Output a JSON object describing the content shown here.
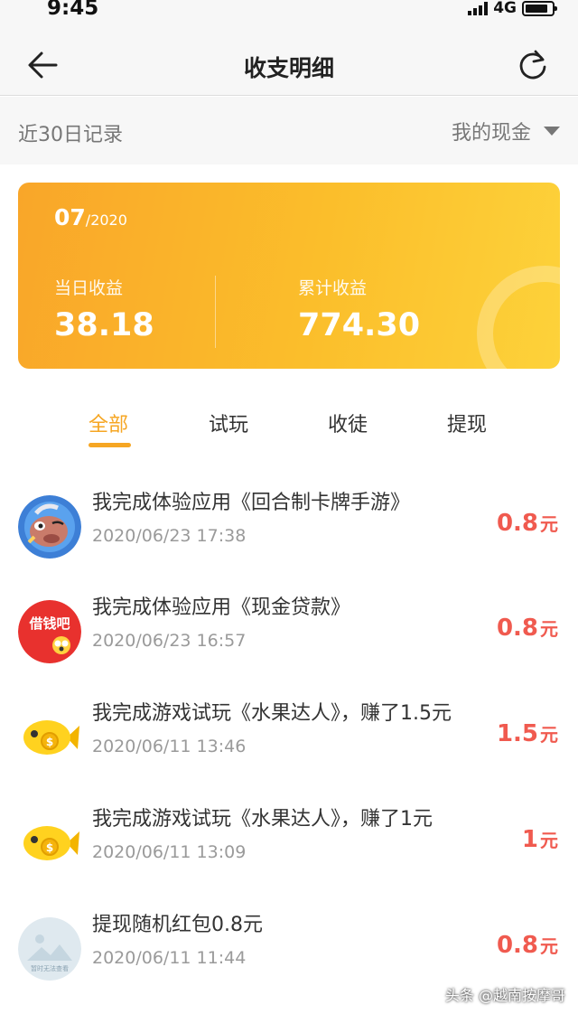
{
  "status_bar": {
    "time": "9:45",
    "network": "4G"
  },
  "nav": {
    "title": "收支明细",
    "back_icon": "arrow-left-icon",
    "refresh_icon": "refresh-icon"
  },
  "filter": {
    "range_label": "近30日记录",
    "wallet_label": "我的现金"
  },
  "card": {
    "month": "07",
    "year": "/2020",
    "today_label": "当日收益",
    "today_value": "38.18",
    "total_label": "累计收益",
    "total_value": "774.30"
  },
  "tabs": [
    {
      "label": "全部",
      "active": true
    },
    {
      "label": "试玩",
      "active": false
    },
    {
      "label": "收徒",
      "active": false
    },
    {
      "label": "提现",
      "active": false
    }
  ],
  "records": [
    {
      "title": "我完成体验应用《回合制卡牌手游》",
      "time": "2020/06/23 17:38",
      "amount": "0.8",
      "unit": "元",
      "icon": "game-character-icon"
    },
    {
      "title": "我完成体验应用《现金贷款》",
      "time": "2020/06/23 16:57",
      "amount": "0.8",
      "unit": "元",
      "icon": "loan-app-icon",
      "icon_text": "借钱吧"
    },
    {
      "title": "我完成游戏试玩《水果达人》，赚了1.5元",
      "time": "2020/06/11 13:46",
      "amount": "1.5",
      "unit": "元",
      "icon": "gold-fish-icon"
    },
    {
      "title": "我完成游戏试玩《水果达人》，赚了1元",
      "time": "2020/06/11 13:09",
      "amount": "1",
      "unit": "元",
      "icon": "gold-fish-icon"
    },
    {
      "title": "提现随机红包0.8元",
      "time": "2020/06/11 11:44",
      "amount": "0.8",
      "unit": "元",
      "icon": "image-placeholder-icon",
      "icon_text": "暂时无法查看"
    }
  ],
  "watermark": "头条 @越南按摩哥",
  "colors": {
    "accent": "#f6a623",
    "amount": "#f05a4f",
    "card_start": "#f9a629",
    "card_end": "#fdd23a"
  }
}
